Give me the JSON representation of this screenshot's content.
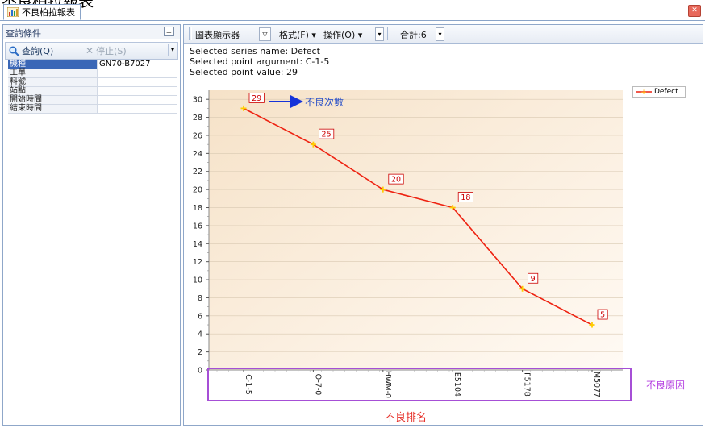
{
  "page_title_fragment": "不良柏拉報表",
  "tab": {
    "label": "不良柏拉報表",
    "close_icon": "close-icon"
  },
  "query_panel": {
    "title": "查詢條件",
    "query_label": "查詢(Q)",
    "stop_label": "停止(S)",
    "params": [
      {
        "key": "機種",
        "value": "GN70-B7027"
      },
      {
        "key": "工單",
        "value": ""
      },
      {
        "key": "料號",
        "value": ""
      },
      {
        "key": "站點",
        "value": ""
      },
      {
        "key": "開始時間",
        "value": ""
      },
      {
        "key": "結束時間",
        "value": ""
      }
    ]
  },
  "chart_toolbar": {
    "viewer_label": "圖表顯示器",
    "format_label": "格式(F)",
    "operation_label": "操作(O)",
    "total_label": "合計:6"
  },
  "selection": {
    "line1": "Selected series name: Defect",
    "line2": "Selected point argument: C-1-5",
    "line3": "Selected point value: 29"
  },
  "annotations": {
    "count": "不良次數",
    "reason": "不良原因",
    "rank": "不良排名"
  },
  "colors": {
    "series_line": "#ee2211",
    "point_marker": "#ffcc00",
    "label_border": "#cc0000",
    "arrow": "#1533d9",
    "reason_box": "#a64fd6",
    "plot_bg_start": "#f6e2c8",
    "plot_bg_end": "#fffaf4"
  },
  "chart_data": {
    "type": "line",
    "title": "",
    "xlabel": "",
    "ylabel": "",
    "categories": [
      "C-1-5",
      "O-7-0",
      "HWM-0",
      "E5104",
      "F5178",
      "M5077"
    ],
    "series": [
      {
        "name": "Defect",
        "values": [
          29,
          25,
          20,
          18,
          9,
          5
        ]
      }
    ],
    "ylim": [
      0,
      31
    ],
    "yticks": [
      0,
      2,
      4,
      6,
      8,
      10,
      12,
      14,
      16,
      18,
      20,
      22,
      24,
      26,
      28,
      30
    ],
    "grid": true,
    "legend": "top-right",
    "data_labels": true
  }
}
